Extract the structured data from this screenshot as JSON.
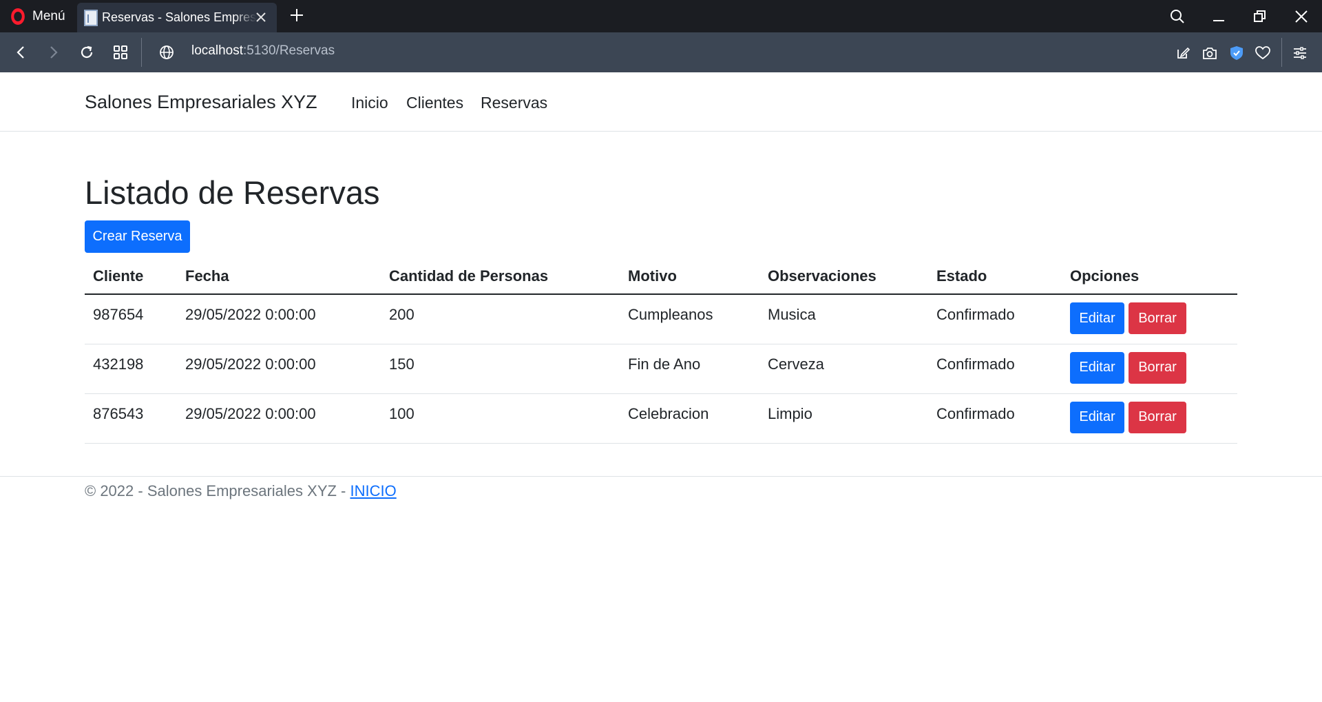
{
  "browser": {
    "menu_label": "Menú",
    "tab_title": "Reservas - Salones Empresariales XYZ",
    "url_host": "localhost",
    "url_rest": ":5130/Reservas"
  },
  "navbar": {
    "brand": "Salones Empresariales XYZ",
    "links": [
      "Inicio",
      "Clientes",
      "Reservas"
    ]
  },
  "main": {
    "title": "Listado de Reservas",
    "create_button": "Crear Reserva",
    "table": {
      "headers": [
        "Cliente",
        "Fecha",
        "Cantidad de Personas",
        "Motivo",
        "Observaciones",
        "Estado",
        "Opciones"
      ],
      "rows": [
        {
          "cliente": "987654",
          "fecha": "29/05/2022 0:00:00",
          "cantidad": "200",
          "motivo": "Cumpleanos",
          "observaciones": "Musica",
          "estado": "Confirmado"
        },
        {
          "cliente": "432198",
          "fecha": "29/05/2022 0:00:00",
          "cantidad": "150",
          "motivo": "Fin de Ano",
          "observaciones": "Cerveza",
          "estado": "Confirmado"
        },
        {
          "cliente": "876543",
          "fecha": "29/05/2022 0:00:00",
          "cantidad": "100",
          "motivo": "Celebracion",
          "observaciones": "Limpio",
          "estado": "Confirmado"
        }
      ],
      "edit_label": "Editar",
      "delete_label": "Borrar"
    }
  },
  "footer": {
    "text": "© 2022 - Salones Empresariales XYZ - ",
    "link": "INICIO"
  },
  "colors": {
    "primary": "#0d6efd",
    "danger": "#dc3545",
    "tabbar": "#1b1d22",
    "addressbar": "#3c4654"
  },
  "icons": {
    "browser_logo": "opera-logo-icon",
    "tab_favicon": "page-icon",
    "tab_close": "close-icon",
    "new_tab": "plus-icon",
    "search": "search-icon",
    "minimize": "minimize-icon",
    "restore": "restore-icon",
    "close": "close-icon",
    "back": "back-arrow-icon",
    "forward": "forward-arrow-icon",
    "reload": "reload-icon",
    "speed_dial": "grid-icon",
    "site_info": "globe-icon",
    "snap_edit": "edit-share-icon",
    "snapshot": "camera-icon",
    "vpn": "shield-icon",
    "favorite": "heart-icon",
    "easy_setup": "sliders-icon"
  }
}
